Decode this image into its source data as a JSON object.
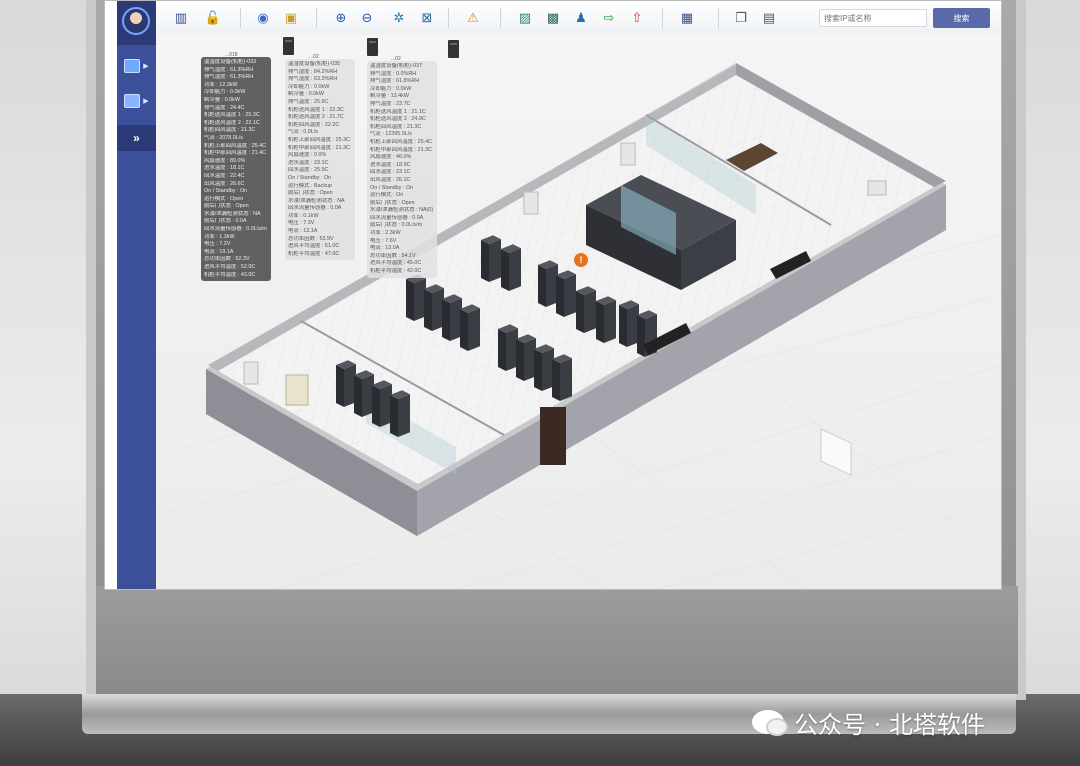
{
  "toolbar": {
    "buttons": [
      {
        "icon": "device-list-icon",
        "glyph": "▥",
        "color": "#3a4a8a"
      },
      {
        "icon": "unlock-icon",
        "glyph": "🔓",
        "color": "#d86a2a"
      },
      {
        "icon": "globe-icon",
        "glyph": "◉",
        "color": "#3a6acb"
      },
      {
        "icon": "box-icon",
        "glyph": "▣",
        "color": "#c89a2a"
      },
      {
        "icon": "zoom-in-icon",
        "glyph": "⊕",
        "color": "#2a5aa8"
      },
      {
        "icon": "zoom-out-icon",
        "glyph": "⊖",
        "color": "#2a5aa8"
      },
      {
        "icon": "rotate-icon",
        "glyph": "✲",
        "color": "#2a7aa8"
      },
      {
        "icon": "fit-screen-icon",
        "glyph": "⊠",
        "color": "#2a6a9a"
      },
      {
        "icon": "alarm-warning-icon",
        "glyph": "⚠",
        "color": "#e08a10"
      },
      {
        "icon": "image-icon",
        "glyph": "▨",
        "color": "#2a8a6a"
      },
      {
        "icon": "picture-icon",
        "glyph": "▩",
        "color": "#2a6a5a"
      },
      {
        "icon": "person-icon",
        "glyph": "♟",
        "color": "#2a6aa8"
      },
      {
        "icon": "export-icon",
        "glyph": "⇨",
        "color": "#2a9a4a"
      },
      {
        "icon": "upload-icon",
        "glyph": "⇧",
        "color": "#c83a2a"
      },
      {
        "icon": "layout-select-icon",
        "glyph": "▦",
        "color": "#3a4a8a"
      },
      {
        "icon": "window-icon",
        "glyph": "❐",
        "color": "#555555"
      },
      {
        "icon": "panel-icon",
        "glyph": "▤",
        "color": "#555555"
      }
    ],
    "search_placeholder": "搜索IP或名称",
    "search_button": "搜索"
  },
  "sidebar": {
    "expand_glyph": "»"
  },
  "panels": [
    {
      "style": "dark",
      "title": "...018",
      "rows": [
        "温湿度设备(机柜)-033",
        "排气湿度 : 61.3%RH",
        "排气湿度 : 61.3%RH",
        "功率 : 12.3kW",
        "冷却能力 : 0.0kW",
        "制冷量 : 0.0kW",
        "排气温度 : 24.4C",
        "机柜送风温度 1 : 25.3C",
        "机柜送风温度 2 : 22.1C",
        "机柜回风温度 : 21.3C",
        "气流 : 2078.0L/s",
        "机柜上部回风温度 : 25.4C",
        "机柜中部回风温度 : 21.4C",
        "风扇速度 : 89.0%",
        "进水温度 : 18.1C",
        "回水温度 : 22.4C",
        "出风温度 : 26.6C",
        "On / Standby : On",
        "运行模式 : Open",
        "前后门状态 : Open",
        "水浸/泄漏检测状态 : NA",
        "前后门状态 : 0.0A",
        "回水流量传感器 : 0.0L/s/m",
        "功率 : 1.3kW",
        "电压 : 7.2V",
        "电流 : 19.1A",
        "总功率因数 : 52.3V",
        "进风平均温度 : 52.0C",
        "机柜平均温度 : 43.0C"
      ]
    },
    {
      "style": "light",
      "title": "...02",
      "rows": [
        "温湿度设备(机柜)-035",
        "排气湿度 : 84.2%RH",
        "排气湿度 : 63.3%RH",
        "冷却能力 : 0.0kW",
        "制冷量 : 0.0kW",
        "排气温度 : 25.9C",
        "机柜送风温度 1 : 22.3C",
        "机柜送风温度 2 : 21.7C",
        "机柜回风温度 : 22.2C",
        "气流 : 0.0L/s",
        "机柜上部回风温度 : 25.3C",
        "机柜中部回风温度 : 21.3C",
        "风扇速度 : 0.0%",
        "进水温度 : 23.1C",
        "回水温度 : 25.9C",
        "On / Standby : On",
        "运行模式 : Backup",
        "前后门状态 : Open",
        "水浸/泄漏检测状态 : NA",
        "回水流量传感器 : 0.0A",
        "功率 : 0.1kW",
        "电压 : 7.3V",
        "电流 : 13.1A",
        "总功率因数 : 53.9V",
        "进风平均温度 : 51.0C",
        "机柜平均温度 : 47.0C"
      ]
    },
    {
      "style": "light",
      "title": "...02",
      "rows": [
        "温湿度设备(机柜)-037",
        "排气湿度 : 0.0%RH",
        "排气湿度 : 61.8%RH",
        "冷却能力 : 0.0kW",
        "制冷量 : 13.4kW",
        "排气温度 : 23.7C",
        "机柜送风温度 1 : 21.1C",
        "机柜送风温度 2 : 24.9C",
        "机柜回风温度 : 21.3C",
        "气流 : 12395.0L/s",
        "机柜上部回风温度 : 25.4C",
        "机柜中部回风温度 : 21.3C",
        "风扇速度 : 46.0%",
        "进水温度 : 18.9C",
        "回水温度 : 23.1C",
        "出风温度 : 26.1C",
        "On / Standby : On",
        "运行模式 : On",
        "前后门状态 : Open",
        "水浸/泄漏检测状态 : NA(0)",
        "回水流量传感器 : 0.0A",
        "前后门状态 : 0.0L/s/m",
        "功率 : 2.3kW",
        "电压 : 7.6V",
        "电流 : 13.0A",
        "总功率因数 : 54.1V",
        "进风平均温度 : 45.0C",
        "机柜平均温度 : 42.0C"
      ]
    }
  ],
  "alarm": {
    "glyph": "!",
    "color": "#e8721c"
  },
  "watermark": {
    "text": "公众号 · 北塔软件"
  }
}
